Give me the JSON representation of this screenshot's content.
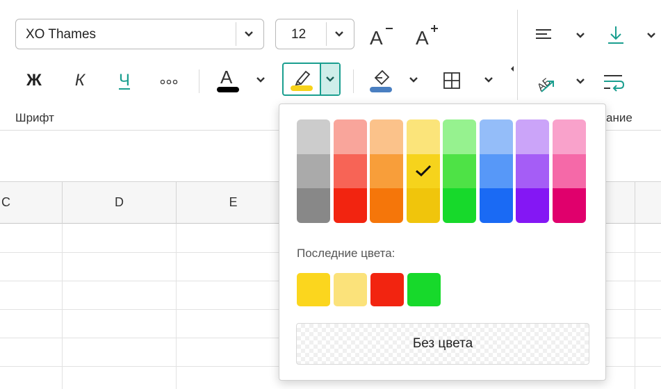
{
  "toolbar": {
    "font_name": "XO Thames",
    "font_size": "12",
    "bold_label": "Ж",
    "italic_label": "К",
    "underline_label": "Ч",
    "font_section_label": "Шрифт",
    "alignment_section_label_partial": "ание",
    "colors": {
      "accent": "#1a9e8f",
      "highlight_active_bg": "#cfeeea",
      "text_color_bar": "#000000",
      "highlight_bar": "#f7d21a",
      "fill_bar": "#4a7fc1"
    }
  },
  "sheet": {
    "columns": [
      "C",
      "D",
      "E"
    ]
  },
  "palette": {
    "columns": [
      {
        "name": "gray",
        "colors": [
          "#cccccc",
          "#aaaaaa",
          "#888888"
        ]
      },
      {
        "name": "red",
        "colors": [
          "#f9a59b",
          "#f76456",
          "#f22410"
        ]
      },
      {
        "name": "orange",
        "colors": [
          "#fbc28a",
          "#f89e3a",
          "#f5760a"
        ]
      },
      {
        "name": "yellow",
        "colors": [
          "#fbe47a",
          "#f6d31c",
          "#f0c50c"
        ]
      },
      {
        "name": "green",
        "colors": [
          "#96f28f",
          "#4ee246",
          "#17d92b"
        ]
      },
      {
        "name": "blue",
        "colors": [
          "#94bdf9",
          "#5798f8",
          "#1a6af4"
        ]
      },
      {
        "name": "purple",
        "colors": [
          "#cba4f9",
          "#a55df6",
          "#8417f4"
        ]
      },
      {
        "name": "pink",
        "colors": [
          "#f9a2cb",
          "#f569a8",
          "#e0006c"
        ]
      }
    ],
    "selected": {
      "column": 3,
      "row": 1
    },
    "recent_title": "Последние цвета:",
    "recent_colors": [
      "#fbd61e",
      "#fbe27a",
      "#f22410",
      "#17d92b"
    ],
    "no_color_label": "Без цвета"
  }
}
